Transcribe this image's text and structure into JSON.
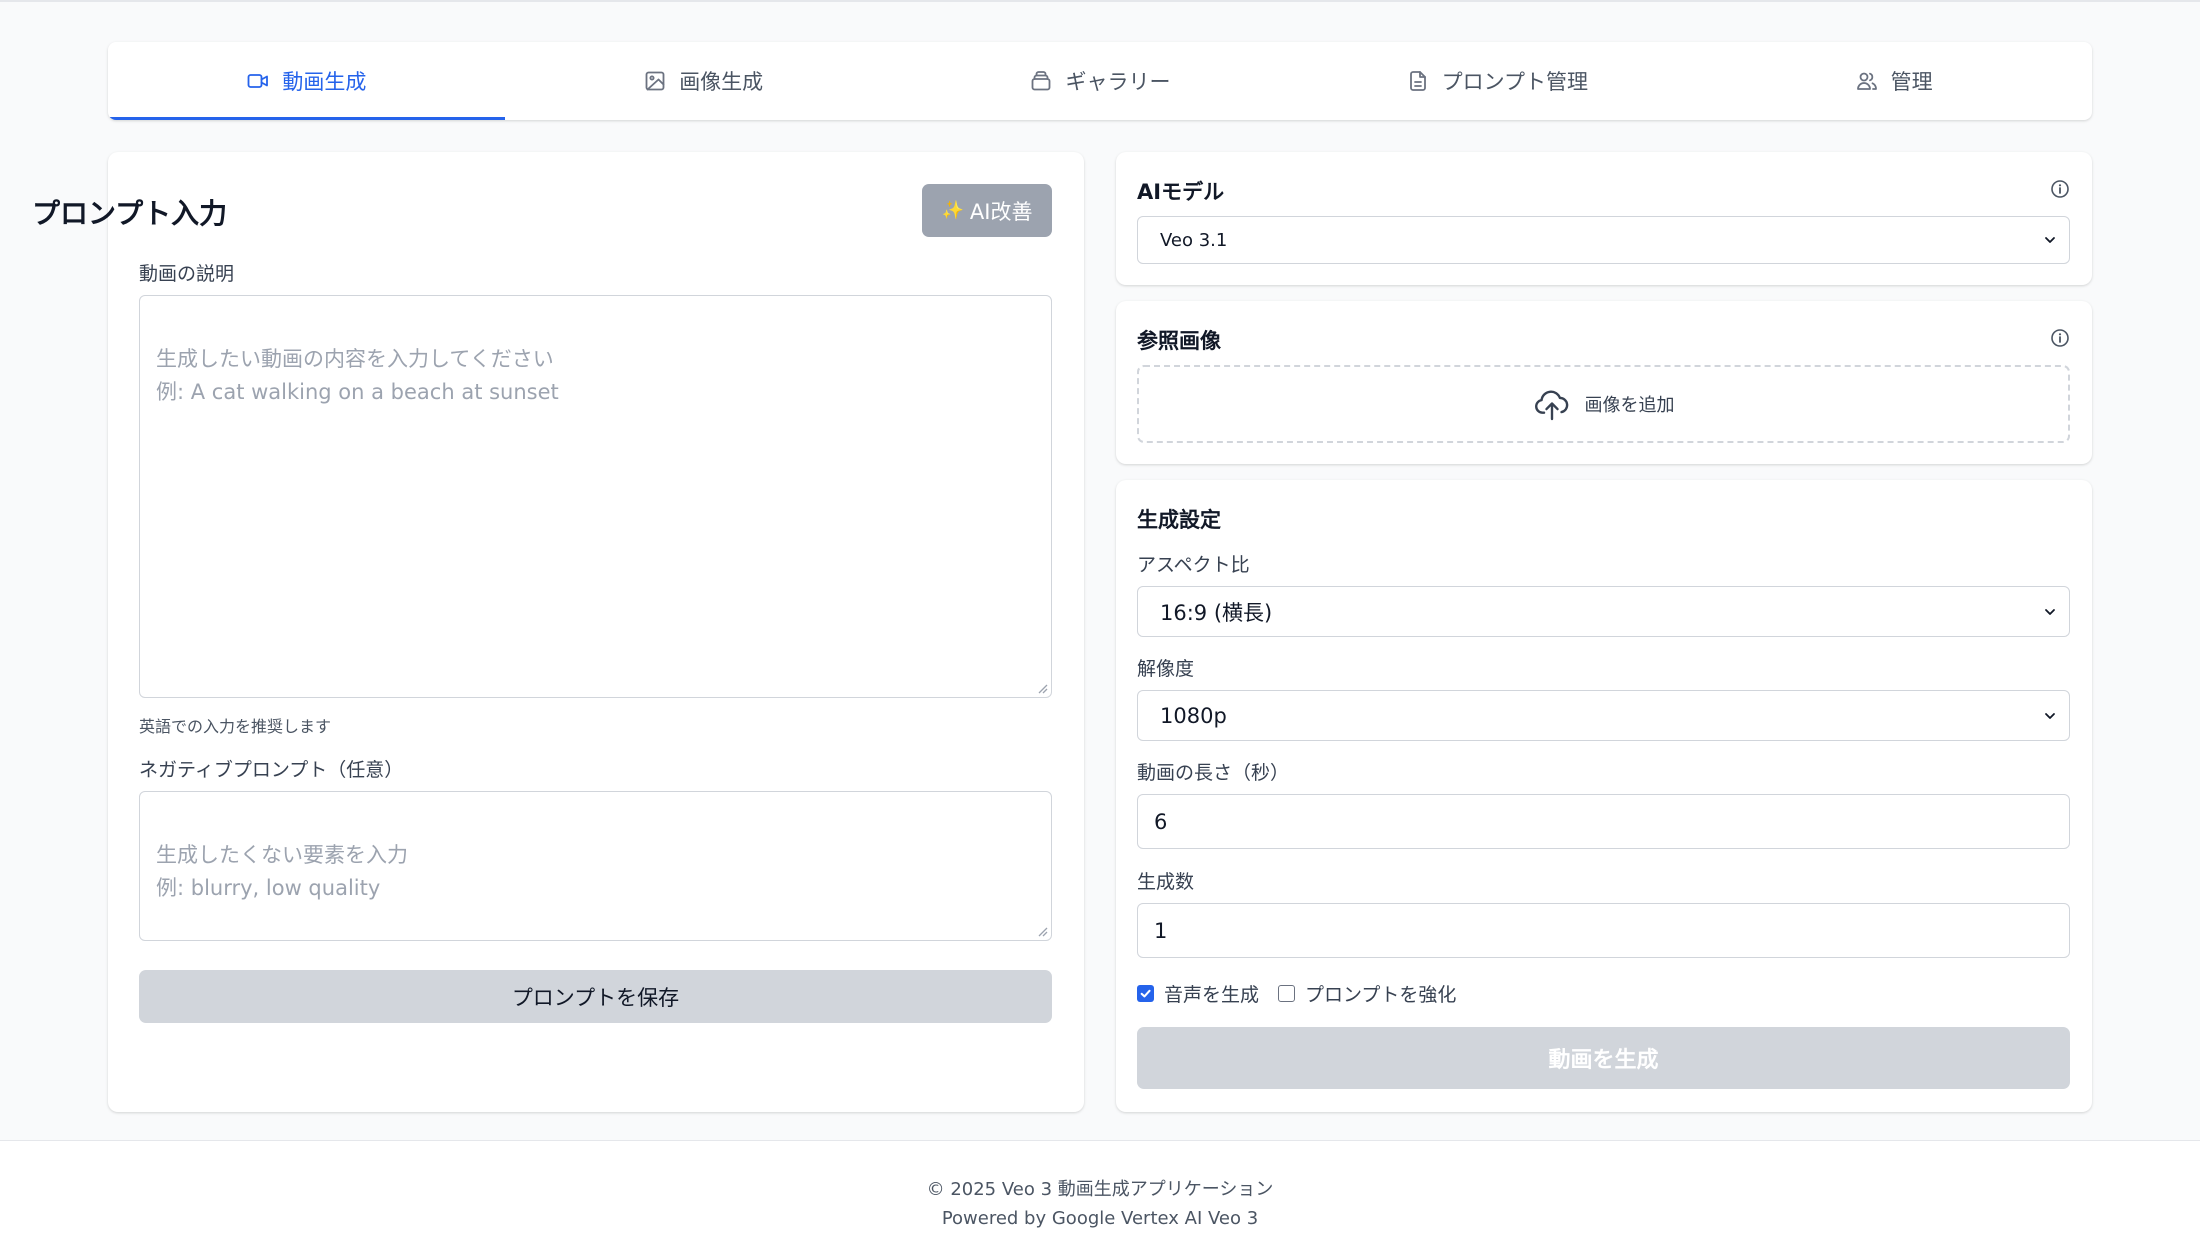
{
  "tabs": [
    {
      "label": "動画生成",
      "icon": "video-icon",
      "active": true
    },
    {
      "label": "画像生成",
      "icon": "image-icon",
      "active": false
    },
    {
      "label": "ギャラリー",
      "icon": "gallery-icon",
      "active": false
    },
    {
      "label": "プロンプト管理",
      "icon": "document-icon",
      "active": false
    },
    {
      "label": "管理",
      "icon": "users-icon",
      "active": false
    }
  ],
  "prompt": {
    "title": "プロンプト入力",
    "ai_improve_label": "AI改善",
    "ai_improve_icon": "✨",
    "description_label": "動画の説明",
    "description_placeholder": "生成したい動画の内容を入力してください\n例: A cat walking on a beach at sunset",
    "description_value": "",
    "hint": "英語での入力を推奨します",
    "negative_label": "ネガティブプロンプト（任意）",
    "negative_placeholder": "生成したくない要素を入力\n例: blurry, low quality",
    "negative_value": "",
    "save_label": "プロンプトを保存"
  },
  "model": {
    "title": "AIモデル",
    "selected": "Veo 3.1"
  },
  "reference": {
    "title": "参照画像",
    "add_label": "画像を追加"
  },
  "settings": {
    "title": "生成設定",
    "aspect_label": "アスペクト比",
    "aspect_value": "16:9 (横長)",
    "resolution_label": "解像度",
    "resolution_value": "1080p",
    "duration_label": "動画の長さ（秒）",
    "duration_value": "6",
    "count_label": "生成数",
    "count_value": "1",
    "audio_label": "音声を生成",
    "audio_checked": true,
    "enhance_label": "プロンプトを強化",
    "enhance_checked": false,
    "generate_label": "動画を生成"
  },
  "footer": {
    "copyright": "© 2025 Veo 3 動画生成アプリケーション",
    "powered": "Powered by Google Vertex AI Veo 3"
  },
  "colors": {
    "accent": "#2563eb",
    "disabled_button": "#d1d5db",
    "ai_button": "#9ca3af"
  }
}
